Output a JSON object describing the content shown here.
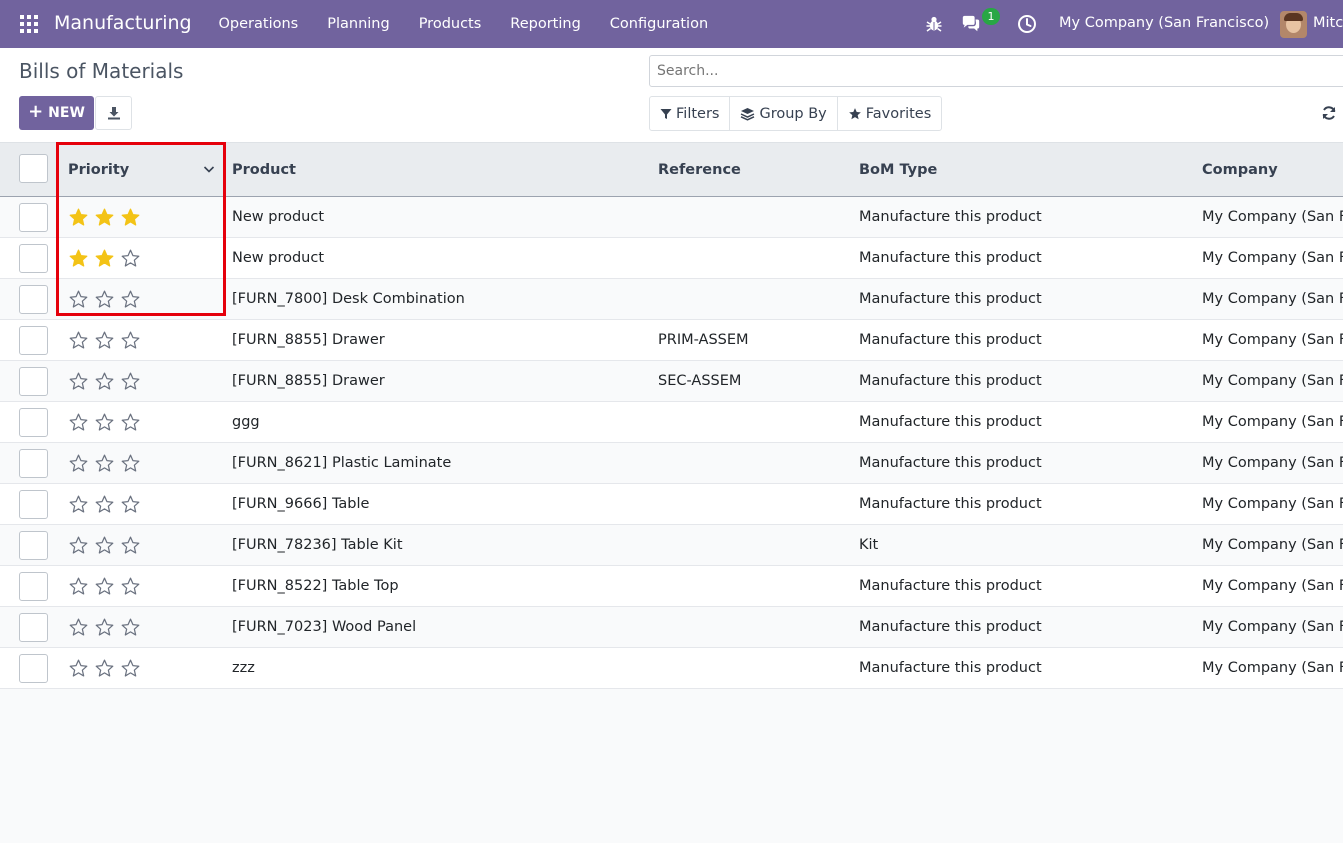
{
  "navbar": {
    "app_name": "Manufacturing",
    "menu": [
      "Operations",
      "Planning",
      "Products",
      "Reporting",
      "Configuration"
    ],
    "chat_badge": "1",
    "company": "My Company (San Francisco)",
    "user": "Mitc",
    "bg_color": "#71639e"
  },
  "control": {
    "title": "Bills of Materials",
    "new_label": "NEW",
    "search_placeholder": "Search...",
    "filters_label": "Filters",
    "groupby_label": "Group By",
    "favorites_label": "Favorites"
  },
  "table": {
    "headers": {
      "priority": "Priority",
      "product": "Product",
      "reference": "Reference",
      "bom_type": "BoM Type",
      "company": "Company"
    },
    "rows": [
      {
        "stars": 3,
        "product": "New product",
        "reference": "",
        "bom_type": "Manufacture this product",
        "company": "My Company (San Fr"
      },
      {
        "stars": 2,
        "product": "New product",
        "reference": "",
        "bom_type": "Manufacture this product",
        "company": "My Company (San Fr"
      },
      {
        "stars": 0,
        "product": "[FURN_7800] Desk Combination",
        "reference": "",
        "bom_type": "Manufacture this product",
        "company": "My Company (San Fr"
      },
      {
        "stars": 0,
        "product": "[FURN_8855] Drawer",
        "reference": "PRIM-ASSEM",
        "bom_type": "Manufacture this product",
        "company": "My Company (San Fr"
      },
      {
        "stars": 0,
        "product": "[FURN_8855] Drawer",
        "reference": "SEC-ASSEM",
        "bom_type": "Manufacture this product",
        "company": "My Company (San Fr"
      },
      {
        "stars": 0,
        "product": "ggg",
        "reference": "",
        "bom_type": "Manufacture this product",
        "company": "My Company (San Fr"
      },
      {
        "stars": 0,
        "product": "[FURN_8621] Plastic Laminate",
        "reference": "",
        "bom_type": "Manufacture this product",
        "company": "My Company (San Fr"
      },
      {
        "stars": 0,
        "product": "[FURN_9666] Table",
        "reference": "",
        "bom_type": "Manufacture this product",
        "company": "My Company (San Fr"
      },
      {
        "stars": 0,
        "product": "[FURN_78236] Table Kit",
        "reference": "",
        "bom_type": "Kit",
        "company": "My Company (San Fr"
      },
      {
        "stars": 0,
        "product": "[FURN_8522] Table Top",
        "reference": "",
        "bom_type": "Manufacture this product",
        "company": "My Company (San Fr"
      },
      {
        "stars": 0,
        "product": "[FURN_7023] Wood Panel",
        "reference": "",
        "bom_type": "Manufacture this product",
        "company": "My Company (San Fr"
      },
      {
        "stars": 0,
        "product": "zzz",
        "reference": "",
        "bom_type": "Manufacture this product",
        "company": "My Company (San Fr"
      }
    ]
  },
  "colors": {
    "accent": "#71639e",
    "star_filled": "#f3c316",
    "highlight": "#e5000b"
  }
}
